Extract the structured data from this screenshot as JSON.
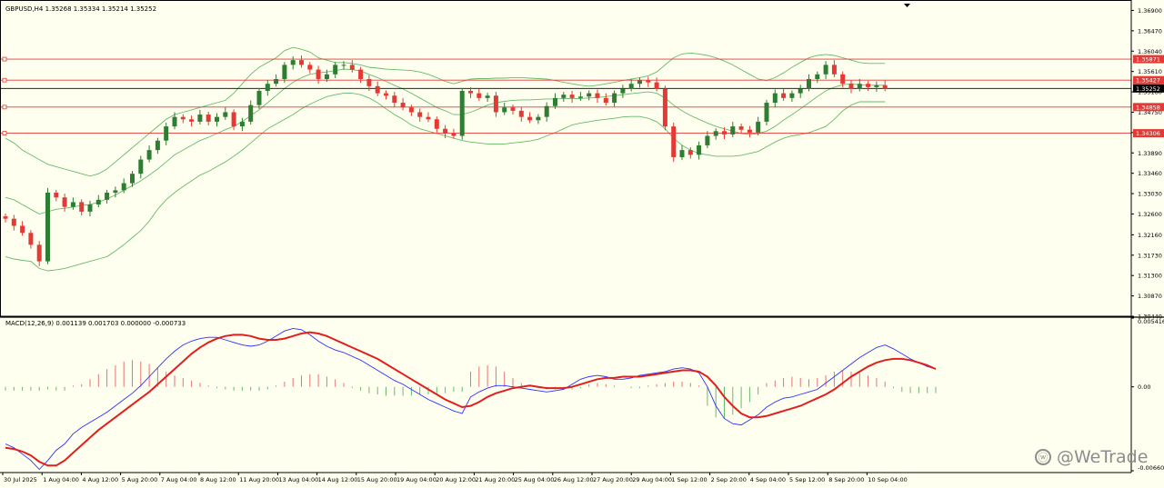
{
  "colors": {
    "background": "#fffff0",
    "bull": "#2e7d32",
    "bear": "#e53935",
    "bands": "#66bb6a",
    "level_line": "#e53935",
    "bid_line": "#000000",
    "macd_line": "#2f2fff",
    "signal_line": "#e0201e",
    "hist_pos": "#e57373",
    "hist_neg": "#66bb6a",
    "grid": "#000000",
    "axis_text": "#000000"
  },
  "watermark": {
    "text": "@WeTrade"
  },
  "chart_data": [
    {
      "type": "candlestick",
      "title": "GBPUSD,H4  1.35268 1.35334 1.35214 1.35252",
      "x_labels": [
        "30 Jul 2025",
        "1 Aug 04:00",
        "4 Aug 12:00",
        "5 Aug 20:00",
        "7 Aug 04:00",
        "8 Aug 12:00",
        "11 Aug 20:00",
        "13 Aug 04:00",
        "14 Aug 12:00",
        "15 Aug 20:00",
        "19 Aug 04:00",
        "20 Aug 12:00",
        "21 Aug 20:00",
        "25 Aug 04:00",
        "26 Aug 12:00",
        "27 Aug 20:00",
        "29 Aug 04:00",
        "1 Sep 12:00",
        "2 Sep 20:00",
        "4 Sep 04:00",
        "5 Sep 12:00",
        "8 Sep 20:00",
        "10 Sep 04:00"
      ],
      "y_ticks": [
        "1.36900",
        "1.36470",
        "1.36040",
        "1.35610",
        "1.35180",
        "1.34750",
        "1.34320",
        "1.33890",
        "1.33460",
        "1.33030",
        "1.32600",
        "1.32160",
        "1.31730",
        "1.31300",
        "1.30870",
        "1.30440"
      ],
      "ylim": [
        1.3044,
        1.3712
      ],
      "level_labels": [
        "1.35871",
        "1.35427",
        "1.35252",
        "1.34858",
        "1.34306"
      ],
      "levels": [
        1.35871,
        1.35427,
        1.34858,
        1.34306
      ],
      "bid": 1.35252,
      "closes": [
        1.325,
        1.3235,
        1.322,
        1.3195,
        1.316,
        1.3305,
        1.3295,
        1.3275,
        1.3285,
        1.3265,
        1.328,
        1.329,
        1.3305,
        1.331,
        1.3325,
        1.3345,
        1.3375,
        1.3395,
        1.3415,
        1.3445,
        1.3465,
        1.346,
        1.3455,
        1.347,
        1.3455,
        1.3465,
        1.3475,
        1.3445,
        1.3455,
        1.349,
        1.352,
        1.3535,
        1.3545,
        1.3575,
        1.3585,
        1.3575,
        1.3565,
        1.3545,
        1.3555,
        1.3575,
        1.3575,
        1.3565,
        1.3545,
        1.353,
        1.3515,
        1.351,
        1.3495,
        1.3485,
        1.3475,
        1.3465,
        1.346,
        1.344,
        1.343,
        1.3425,
        1.352,
        1.3515,
        1.3505,
        1.351,
        1.3475,
        1.3485,
        1.3478,
        1.3465,
        1.3458,
        1.3465,
        1.3488,
        1.3505,
        1.3512,
        1.3505,
        1.3508,
        1.3515,
        1.3505,
        1.3495,
        1.3515,
        1.3525,
        1.3535,
        1.3542,
        1.3538,
        1.3525,
        1.3445,
        1.338,
        1.3395,
        1.3385,
        1.3405,
        1.3425,
        1.3435,
        1.3428,
        1.3445,
        1.3438,
        1.3432,
        1.3455,
        1.3495,
        1.3515,
        1.3505,
        1.3515,
        1.3525,
        1.3545,
        1.3555,
        1.3575,
        1.3555,
        1.3535,
        1.3525,
        1.3535,
        1.3528,
        1.3532,
        1.35252
      ],
      "series": [
        {
          "name": "Bollinger upper",
          "values": [
            1.342,
            1.341,
            1.3395,
            1.3385,
            1.3375,
            1.3365,
            1.336,
            1.3355,
            1.335,
            1.3345,
            1.334,
            1.3345,
            1.3355,
            1.337,
            1.3385,
            1.34,
            1.3415,
            1.343,
            1.3445,
            1.346,
            1.347,
            1.3475,
            1.348,
            1.3485,
            1.349,
            1.3495,
            1.35,
            1.3515,
            1.3535,
            1.3555,
            1.357,
            1.358,
            1.359,
            1.3605,
            1.3612,
            1.3608,
            1.3602,
            1.359,
            1.3585,
            1.358,
            1.358,
            1.3578,
            1.3575,
            1.357,
            1.3568,
            1.3566,
            1.3565,
            1.3564,
            1.3563,
            1.356,
            1.3555,
            1.3548,
            1.354,
            1.3535,
            1.354,
            1.3545,
            1.3546,
            1.3546,
            1.3547,
            1.3547,
            1.3548,
            1.3548,
            1.3547,
            1.3546,
            1.3545,
            1.3542,
            1.3538,
            1.3535,
            1.3532,
            1.353,
            1.3532,
            1.3535,
            1.3538,
            1.3542,
            1.3545,
            1.3548,
            1.3552,
            1.356,
            1.3575,
            1.359,
            1.3598,
            1.36,
            1.3598,
            1.3595,
            1.359,
            1.3583,
            1.3575,
            1.3565,
            1.3555,
            1.3545,
            1.3542,
            1.3548,
            1.3558,
            1.357,
            1.358,
            1.359,
            1.3595,
            1.3597,
            1.3595,
            1.359,
            1.3585,
            1.358,
            1.3578,
            1.3578,
            1.3578
          ]
        },
        {
          "name": "Bollinger middle",
          "values": [
            1.3295,
            1.329,
            1.328,
            1.327,
            1.326,
            1.3265,
            1.327,
            1.3272,
            1.3275,
            1.3278,
            1.328,
            1.3285,
            1.3292,
            1.33,
            1.331,
            1.332,
            1.333,
            1.3342,
            1.3355,
            1.337,
            1.3385,
            1.3395,
            1.3405,
            1.3415,
            1.3422,
            1.343,
            1.3438,
            1.3445,
            1.3455,
            1.3468,
            1.348,
            1.3495,
            1.351,
            1.3525,
            1.3538,
            1.3548,
            1.3555,
            1.3558,
            1.356,
            1.3563,
            1.3566,
            1.3565,
            1.3562,
            1.3555,
            1.3548,
            1.354,
            1.3532,
            1.3524,
            1.3515,
            1.3505,
            1.3495,
            1.3485,
            1.3478,
            1.347,
            1.347,
            1.3475,
            1.3482,
            1.349,
            1.3495,
            1.3498,
            1.35,
            1.3501,
            1.3501,
            1.3502,
            1.3503,
            1.3503,
            1.3504,
            1.3504,
            1.3504,
            1.3505,
            1.3506,
            1.3508,
            1.351,
            1.3512,
            1.3514,
            1.3516,
            1.3518,
            1.3515,
            1.3505,
            1.349,
            1.3478,
            1.3468,
            1.346,
            1.3452,
            1.3445,
            1.344,
            1.3435,
            1.343,
            1.3428,
            1.343,
            1.3435,
            1.3445,
            1.3458,
            1.347,
            1.3482,
            1.3495,
            1.3508,
            1.352,
            1.3528,
            1.3533,
            1.3535,
            1.3533,
            1.3532,
            1.3532,
            1.3532
          ]
        },
        {
          "name": "Bollinger lower",
          "values": [
            1.317,
            1.3165,
            1.3162,
            1.316,
            1.3145,
            1.314,
            1.3142,
            1.3145,
            1.315,
            1.3155,
            1.316,
            1.3165,
            1.317,
            1.3182,
            1.3195,
            1.321,
            1.3225,
            1.3245,
            1.327,
            1.329,
            1.3305,
            1.3318,
            1.333,
            1.3342,
            1.335,
            1.336,
            1.337,
            1.3382,
            1.3395,
            1.341,
            1.3425,
            1.344,
            1.345,
            1.346,
            1.347,
            1.3482,
            1.3492,
            1.35,
            1.3508,
            1.3512,
            1.3515,
            1.3515,
            1.3512,
            1.3505,
            1.3495,
            1.3482,
            1.347,
            1.346,
            1.3448,
            1.344,
            1.3435,
            1.343,
            1.3425,
            1.342,
            1.3415,
            1.3412,
            1.341,
            1.3408,
            1.3408,
            1.3408,
            1.341,
            1.3412,
            1.3414,
            1.3418,
            1.3425,
            1.3432,
            1.344,
            1.3448,
            1.3452,
            1.3455,
            1.3458,
            1.346,
            1.3462,
            1.3465,
            1.3466,
            1.3466,
            1.3462,
            1.3455,
            1.344,
            1.342,
            1.3405,
            1.3395,
            1.3388,
            1.3385,
            1.3382,
            1.3382,
            1.3382,
            1.3384,
            1.3388,
            1.3392,
            1.3402,
            1.3412,
            1.342,
            1.3425,
            1.3428,
            1.3432,
            1.3438,
            1.3445,
            1.346,
            1.3478,
            1.349,
            1.3497,
            1.3497,
            1.3497,
            1.3497
          ]
        }
      ]
    },
    {
      "type": "line",
      "title": "MACD(12,26,9) 0.001139 0.001703 0.000000 -0.000733",
      "y_ticks": [
        "0.005416",
        "0.00",
        "-0.006609"
      ],
      "ylim": [
        -0.006609,
        0.005416
      ],
      "histogram": [
        -0.0003,
        -0.0003,
        -0.0003,
        -0.0003,
        -0.0003,
        -0.0002,
        -0.0003,
        -0.0003,
        0.0001,
        0.0002,
        0.0006,
        0.001,
        0.0014,
        0.0017,
        0.002,
        0.0021,
        0.002,
        0.0018,
        0.0015,
        0.0012,
        0.0009,
        0.0007,
        0.0005,
        0.0003,
        0.0001,
        -0.0001,
        -0.0002,
        -0.0003,
        -0.0003,
        -0.0003,
        -0.0003,
        -0.0002,
        0.0001,
        0.0004,
        0.0007,
        0.0009,
        0.001,
        0.001,
        0.0008,
        0.0006,
        0.0003,
        -0.0001,
        -0.0003,
        -0.0005,
        -0.0006,
        -0.0007,
        -0.0007,
        -0.0007,
        -0.0007,
        -0.0006,
        -0.0006,
        -0.0005,
        -0.0005,
        -0.0004,
        -0.0004,
        0.0012,
        0.0016,
        0.0017,
        0.0016,
        0.0012,
        0.0007,
        0.0003,
        0.0001,
        -0.0001,
        -0.0002,
        -0.0002,
        -0.0002,
        -0.0002,
        -0.0001,
        0.0002,
        0.0003,
        0.0002,
        0.0001,
        0.0,
        -0.0001,
        -0.0001,
        0.0001,
        0.0002,
        0.0003,
        0.0004,
        0.0004,
        0.0003,
        0.0001,
        -0.0015,
        -0.0024,
        -0.0025,
        -0.0022,
        -0.0017,
        -0.0012,
        -0.0006,
        0.0003,
        0.0005,
        0.0007,
        0.0008,
        0.0007,
        0.0006,
        0.0007,
        0.0009,
        0.0012,
        0.0013,
        0.0012,
        0.0011,
        0.0009,
        0.0007,
        0.0004,
        -0.0001,
        -0.0004,
        -0.0005,
        -0.0005,
        -0.0005,
        -0.0005
      ],
      "series": [
        {
          "name": "MACD",
          "values": [
            -0.0045,
            -0.0048,
            -0.0053,
            -0.0058,
            -0.0065,
            -0.0058,
            -0.005,
            -0.0045,
            -0.0037,
            -0.0032,
            -0.0028,
            -0.0024,
            -0.002,
            -0.0015,
            -0.001,
            -0.0005,
            0.0001,
            0.0008,
            0.0015,
            0.0022,
            0.0028,
            0.0033,
            0.0036,
            0.0038,
            0.0039,
            0.0039,
            0.0037,
            0.0035,
            0.0033,
            0.0032,
            0.0033,
            0.0036,
            0.004,
            0.0044,
            0.0046,
            0.0045,
            0.0041,
            0.0036,
            0.0032,
            0.0029,
            0.0027,
            0.0024,
            0.0021,
            0.0017,
            0.0013,
            0.0009,
            0.0005,
            0.0002,
            -0.0002,
            -0.0006,
            -0.001,
            -0.0013,
            -0.0016,
            -0.0019,
            -0.0021,
            -0.0008,
            -0.0004,
            -0.0001,
            0.0001,
            0.0001,
            0.0,
            -0.0001,
            -0.0002,
            -0.0003,
            -0.0004,
            -0.0003,
            -0.0002,
            0.0002,
            0.0006,
            0.0008,
            0.0009,
            0.0008,
            0.0006,
            0.0006,
            0.0007,
            0.0009,
            0.001,
            0.0011,
            0.0012,
            0.0014,
            0.0015,
            0.0014,
            0.0011,
            0.0,
            -0.0015,
            -0.0025,
            -0.0029,
            -0.003,
            -0.0026,
            -0.0022,
            -0.0016,
            -0.0012,
            -0.0009,
            -0.0008,
            -0.0006,
            -0.0004,
            -0.0002,
            0.0003,
            0.0008,
            0.0013,
            0.0018,
            0.0023,
            0.0027,
            0.0031,
            0.0033,
            0.003,
            0.0026,
            0.0022,
            0.0019,
            0.0016,
            0.0014
          ]
        },
        {
          "name": "Signal",
          "values": [
            -0.0048,
            -0.0049,
            -0.0051,
            -0.0054,
            -0.0059,
            -0.0062,
            -0.0062,
            -0.0058,
            -0.0052,
            -0.0046,
            -0.004,
            -0.0034,
            -0.0029,
            -0.0024,
            -0.0019,
            -0.0014,
            -0.0009,
            -0.0004,
            0.0002,
            0.0008,
            0.0014,
            0.002,
            0.0026,
            0.0031,
            0.0035,
            0.0038,
            0.004,
            0.0041,
            0.0041,
            0.004,
            0.0038,
            0.0037,
            0.0037,
            0.0038,
            0.004,
            0.0042,
            0.0043,
            0.0042,
            0.004,
            0.0037,
            0.0034,
            0.0031,
            0.0028,
            0.0025,
            0.0022,
            0.0018,
            0.0014,
            0.001,
            0.0006,
            0.0002,
            -0.0002,
            -0.0006,
            -0.001,
            -0.0013,
            -0.0016,
            -0.0015,
            -0.0012,
            -0.0008,
            -0.0005,
            -0.0003,
            -0.0001,
            0.0,
            0.0001,
            0.0,
            -0.0001,
            -0.0001,
            -0.0001,
            0.0,
            0.0002,
            0.0004,
            0.0006,
            0.0007,
            0.0007,
            0.0008,
            0.0008,
            0.0008,
            0.0009,
            0.001,
            0.0011,
            0.0012,
            0.0013,
            0.0013,
            0.0012,
            0.0008,
            0.0001,
            -0.0008,
            -0.0015,
            -0.0021,
            -0.0024,
            -0.0024,
            -0.0023,
            -0.0021,
            -0.0019,
            -0.0017,
            -0.0015,
            -0.0012,
            -0.0009,
            -0.0006,
            -0.0002,
            0.0003,
            0.0008,
            0.0012,
            0.0016,
            0.0019,
            0.0021,
            0.0022,
            0.0022,
            0.0021,
            0.0019,
            0.0017,
            0.0014
          ]
        }
      ]
    }
  ]
}
